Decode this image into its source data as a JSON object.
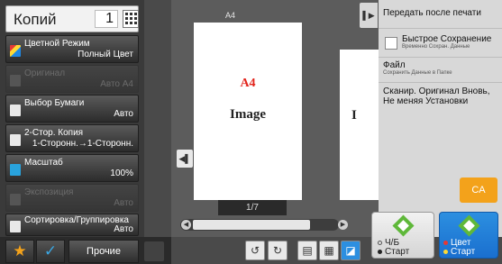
{
  "copies": {
    "label": "Копий",
    "value": "1"
  },
  "menu": [
    {
      "label": "Цветной Режим",
      "value": "Полный Цвет",
      "enabled": true,
      "icon": "color-mode-icon"
    },
    {
      "label": "Оригинал",
      "value": "Авто A4",
      "enabled": false,
      "icon": "original-icon"
    },
    {
      "label": "Выбор Бумаги",
      "value": "Авто",
      "enabled": true,
      "icon": "paper-select-icon"
    },
    {
      "label": "2-Стор. Копия",
      "value": "1-Сторонн.→1-Сторонн.",
      "enabled": true,
      "icon": "duplex-icon"
    },
    {
      "label": "Масштаб",
      "value": "100%",
      "enabled": true,
      "icon": "zoom-icon"
    },
    {
      "label": "Экспозиция",
      "value": "Авто",
      "enabled": false,
      "icon": "exposure-icon"
    },
    {
      "label": "Сортировка/Группировка",
      "value": "Авто",
      "enabled": true,
      "icon": "sort-icon"
    }
  ],
  "bottom": {
    "other_label": "Прочие"
  },
  "preview": {
    "paper_size": "A4",
    "page_label_a4": "A4",
    "page_label_image": "Image",
    "page_right_text": "I",
    "page_counter": "1/7"
  },
  "tasks": {
    "send_after_print": "Передать после печати",
    "quick_save_title": "Быстрое Сохранение",
    "quick_save_sub": "Временно Сохран. Данные",
    "file_title": "Файл",
    "file_sub": "Сохранить Данные в Папке",
    "rescan_title": "Сканир. Оригинал Вновь, Не меняя Установки"
  },
  "ca_label": "CA",
  "start_bw": {
    "line1": "Ч/Б",
    "line2": "Старт"
  },
  "start_color": {
    "line1": "Цвет",
    "line2": "Старт"
  },
  "colors": {
    "accent_orange": "#f3a21b",
    "start_blue": "#1a6fcf",
    "start_green": "#5fb83a"
  }
}
